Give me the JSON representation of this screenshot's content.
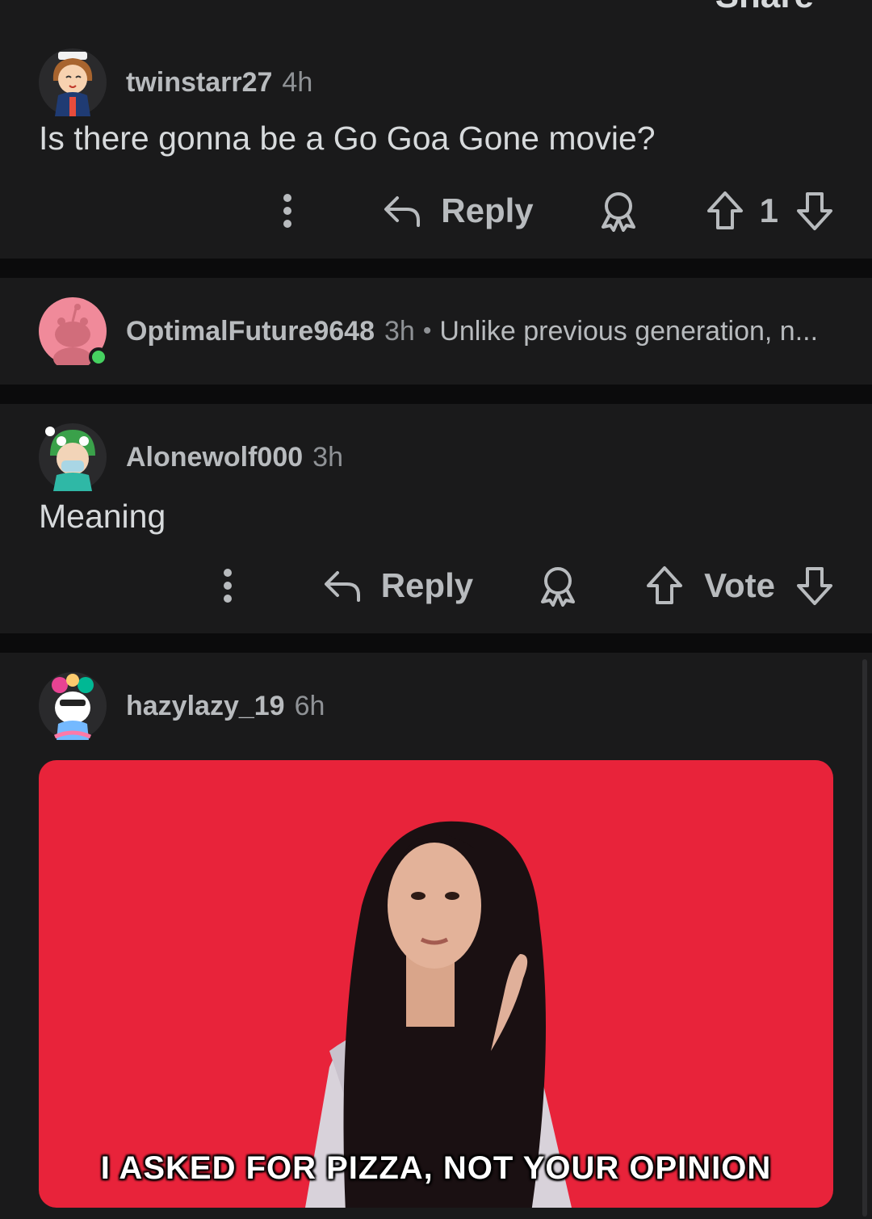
{
  "topbar": {
    "share_label": "Share"
  },
  "comments": [
    {
      "username": "twinstarr27",
      "time": "4h",
      "body": "Is there gonna be a Go Goa Gone movie?",
      "reply_label": "Reply",
      "vote_count": "1"
    },
    {
      "username": "OptimalFuture9648",
      "time": "3h",
      "separator": "•",
      "snippet": "Unlike previous generation, n..."
    },
    {
      "username": "Alonewolf000",
      "time": "3h",
      "body": "Meaning",
      "reply_label": "Reply",
      "vote_label": "Vote"
    },
    {
      "username": "hazylazy_19",
      "time": "6h",
      "gif_caption": "I ASKED FOR PIZZA, NOT YOUR OPINION"
    }
  ],
  "colors": {
    "background": "#0b0b0c",
    "card": "#1a1a1b",
    "text": "#d7dadc",
    "muted": "#8f9296",
    "online": "#46d160",
    "gif_background": "#e8233a"
  },
  "icons": [
    "more-vertical-icon",
    "reply-icon",
    "award-icon",
    "upvote-icon",
    "downvote-icon"
  ]
}
